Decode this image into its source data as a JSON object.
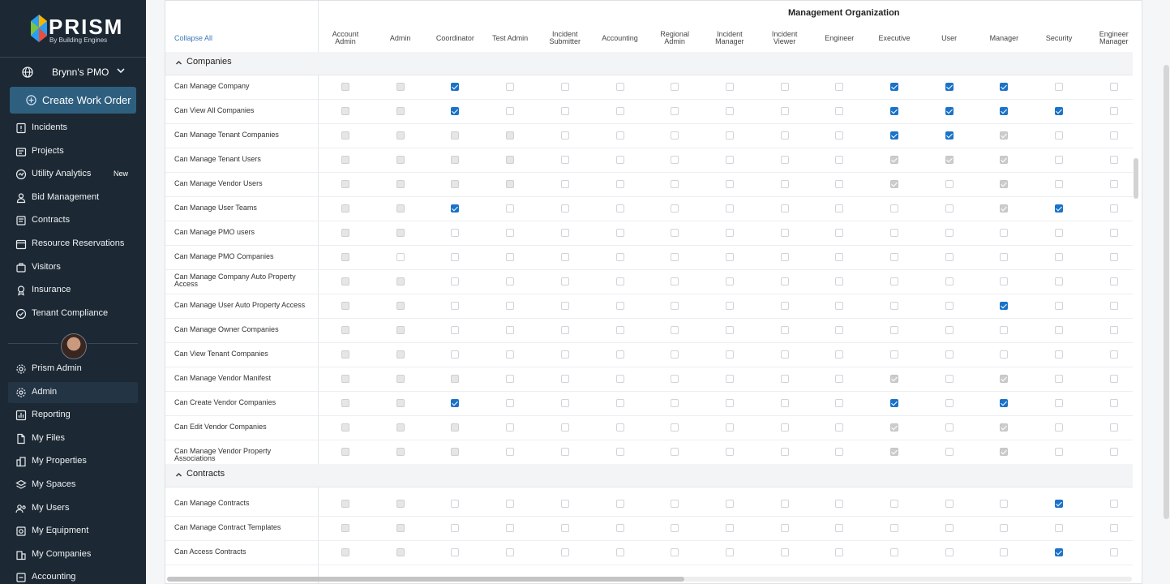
{
  "brand": {
    "name": "PRISM",
    "tagline": "By Building Engines"
  },
  "org": {
    "name": "Brynn's PMO"
  },
  "create_button": "Create Work Order",
  "nav_top": [
    {
      "label": "Incidents",
      "icon": "incidents-icon"
    },
    {
      "label": "Projects",
      "icon": "projects-icon"
    },
    {
      "label": "Utility Analytics",
      "icon": "utility-analytics-icon",
      "badge": "New"
    },
    {
      "label": "Bid Management",
      "icon": "bid-management-icon"
    },
    {
      "label": "Contracts",
      "icon": "contracts-icon"
    },
    {
      "label": "Resource Reservations",
      "icon": "calendar-icon"
    },
    {
      "label": "Visitors",
      "icon": "visitors-icon"
    },
    {
      "label": "Insurance",
      "icon": "insurance-icon"
    },
    {
      "label": "Tenant Compliance",
      "icon": "compliance-icon"
    }
  ],
  "nav_bottom": [
    {
      "label": "Prism Admin",
      "icon": "gear-icon"
    },
    {
      "label": "Admin",
      "icon": "gear-icon",
      "active": true
    },
    {
      "label": "Reporting",
      "icon": "reporting-icon"
    },
    {
      "label": "My Files",
      "icon": "file-icon"
    },
    {
      "label": "My Properties",
      "icon": "properties-icon"
    },
    {
      "label": "My Spaces",
      "icon": "spaces-icon"
    },
    {
      "label": "My Users",
      "icon": "users-icon"
    },
    {
      "label": "My Equipment",
      "icon": "equipment-icon"
    },
    {
      "label": "My Companies",
      "icon": "companies-icon"
    },
    {
      "label": "Accounting",
      "icon": "accounting-icon"
    }
  ],
  "table": {
    "group_title": "Management Organization",
    "collapse_label": "Collapse All",
    "columns": [
      [
        "Account",
        "Admin"
      ],
      [
        "Admin"
      ],
      [
        "Coordinator"
      ],
      [
        "Test Admin"
      ],
      [
        "Incident",
        "Submitter"
      ],
      [
        "Accounting"
      ],
      [
        "Regional",
        "Admin"
      ],
      [
        "Incident",
        "Manager"
      ],
      [
        "Incident",
        "Viewer"
      ],
      [
        "Engineer"
      ],
      [
        "Executive"
      ],
      [
        "User"
      ],
      [
        "Manager"
      ],
      [
        "Security"
      ],
      [
        "Engineer",
        "Manager"
      ]
    ],
    "legend": "d = disabled, D = disabled checked, u = unchecked, c = checked",
    "sections": [
      {
        "title": "Companies",
        "rows": [
          {
            "label": "Can Manage Company",
            "states": "ddcuuuuuuucccuu"
          },
          {
            "label": "Can View All Companies",
            "states": "ddcuuuuuuuccccu"
          },
          {
            "label": "Can Manage Tenant Companies",
            "states": "dddduuuuuuccDuu"
          },
          {
            "label": "Can Manage Tenant Users",
            "states": "dddduuuuuuDDDuu"
          },
          {
            "label": "Can Manage Vendor Users",
            "states": "dddduuuuuuDuDuu"
          },
          {
            "label": "Can Manage User Teams",
            "states": "ddcuuuuuuuuuDcu"
          },
          {
            "label": "Can Manage PMO users",
            "states": "dduuuuuuuuuuuuu"
          },
          {
            "label": "Can Manage PMO Companies",
            "states": "duuuuuuuuuuuuuu"
          },
          {
            "label": "Can Manage Company Auto Property Access",
            "states": "dduuuuuuuuuuuuu"
          },
          {
            "label": "Can Manage User Auto Property Access",
            "states": "dduuuuuuuuuucuu"
          },
          {
            "label": "Can Manage Owner Companies",
            "states": "dduuuuuuuuuuuuu"
          },
          {
            "label": "Can View Tenant Companies",
            "states": "dduuuuuuuuuuuuu"
          },
          {
            "label": "Can Manage Vendor Manifest",
            "states": "ddduuuuuuuDuDuu"
          },
          {
            "label": "Can Create Vendor Companies",
            "states": "ddcuuuuuuucucuu"
          },
          {
            "label": "Can Edit Vendor Companies",
            "states": "ddduuuuuuuDuDuu"
          },
          {
            "label": "Can Manage Vendor Property Associations",
            "states": "ddduuuuuuuDuDuu"
          }
        ]
      },
      {
        "title": "Contracts",
        "rows": [
          {
            "label": "Can Manage Contracts",
            "states": "dduuuuuuuuuuucu"
          },
          {
            "label": "Can Manage Contract Templates",
            "states": "dduuuuuuuuuuuuu"
          },
          {
            "label": "Can Access Contracts",
            "states": "dduuuuuuuuuuucu"
          }
        ]
      }
    ]
  },
  "colors": {
    "sidebar": "#1c2833",
    "accent": "#1a73c8",
    "button": "#2f5f7f",
    "link": "#3a78b5"
  }
}
